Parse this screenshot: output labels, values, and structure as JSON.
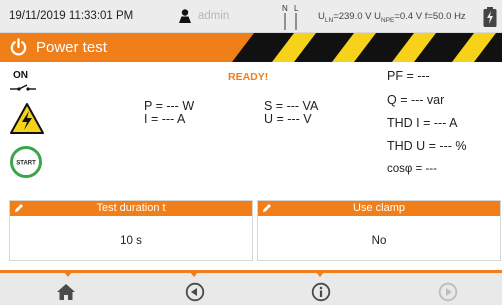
{
  "status_bar": {
    "datetime": "19/11/2019 11:33:01 PM",
    "user": "admin",
    "voltage_ln": "U",
    "voltage_ln_sub": "LN",
    "voltage_ln_value": "=239.0 V",
    "voltage_npe": "U",
    "voltage_npe_sub": "NPE",
    "voltage_npe_value": "=0.4 V",
    "frequency": "f=50.0 Hz",
    "nl_label_n": "N",
    "nl_label_l": "L"
  },
  "title_bar": {
    "title": "Power test"
  },
  "indicators": {
    "on_label": "ON",
    "start_label": "START",
    "status": "READY!"
  },
  "measurements": {
    "p": "P = --- W",
    "i": "I = --- A",
    "s": "S = --- VA",
    "u": "U = --- V",
    "pf": "PF = ---",
    "q": "Q = --- var",
    "thd_i": "THD I = --- A",
    "thd_u": "THD U = --- %",
    "cos_phi": "cosφ = ---"
  },
  "params": [
    {
      "label": "Test duration t",
      "value": "10 s"
    },
    {
      "label": "Use clamp",
      "value": "No"
    }
  ],
  "colors": {
    "accent": "#f07f1a",
    "start_ring": "#3aa64a",
    "warning_yellow": "#f6d21a"
  },
  "nav": [
    {
      "icon": "home-icon"
    },
    {
      "icon": "back-icon"
    },
    {
      "icon": "info-icon"
    },
    {
      "icon": "forward-icon"
    }
  ]
}
